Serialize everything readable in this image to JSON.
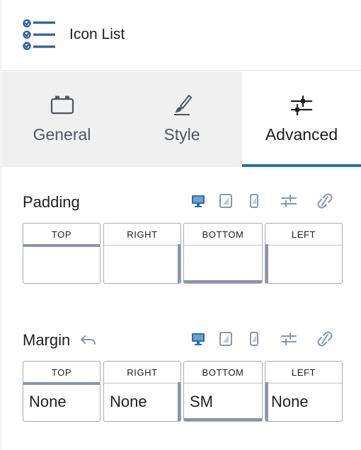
{
  "header": {
    "title": "Icon List",
    "icon": "list-check-icon"
  },
  "tabs": [
    {
      "label": "General",
      "icon": "calendar-box-icon",
      "active": false
    },
    {
      "label": "Style",
      "icon": "brush-icon",
      "active": false
    },
    {
      "label": "Advanced",
      "icon": "sliders-icon",
      "active": true
    }
  ],
  "padding": {
    "title": "Padding",
    "top": {
      "label": "TOP",
      "value": ""
    },
    "right": {
      "label": "RIGHT",
      "value": ""
    },
    "bottom": {
      "label": "BOTTOM",
      "value": ""
    },
    "left": {
      "label": "LEFT",
      "value": ""
    }
  },
  "margin": {
    "title": "Margin",
    "top": {
      "label": "TOP",
      "value": "None"
    },
    "right": {
      "label": "RIGHT",
      "value": "None"
    },
    "bottom": {
      "label": "BOTTOM",
      "value": "SM"
    },
    "left": {
      "label": "LEFT",
      "value": "None"
    }
  },
  "colors": {
    "accent": "#2271b1",
    "icon_muted": "#8c96a6",
    "tab_bg": "#f0f0f1"
  }
}
